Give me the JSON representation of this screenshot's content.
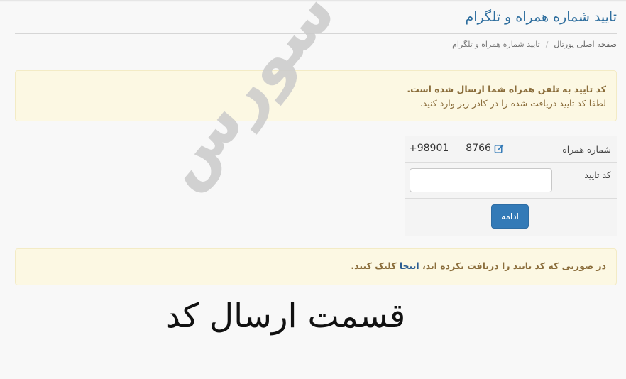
{
  "page": {
    "title": "تایید شماره همراه و تلگرام"
  },
  "breadcrumb": {
    "home": "صفحه اصلی پورتال",
    "separator": "/",
    "current": "تایید شماره همراه و تلگرام"
  },
  "alert_top": {
    "line1": "کد تایید به تلفن همراه شما ارسال شده است.",
    "line2": "لطفا کد تایید دریافت شده را در کادر زیر وارد کنید."
  },
  "form": {
    "phone_label": "شماره همراه",
    "phone_prefix": "+98901",
    "phone_suffix": "8766",
    "code_label": "کد تایید",
    "code_value": "",
    "submit_label": "ادامه"
  },
  "alert_bottom": {
    "text_before": "در صورتی که کد تایید را دریافت نکرده اید، ",
    "link": "اینجا",
    "text_after": " کلیک کنید."
  },
  "overlay": {
    "watermark": "گلدن سورس",
    "caption": "قسمت ارسال کد"
  },
  "colors": {
    "title": "#2e6e9e",
    "primary_button": "#337ab7",
    "alert_background": "#fcf8e3",
    "alert_text": "#8a6d3b"
  }
}
